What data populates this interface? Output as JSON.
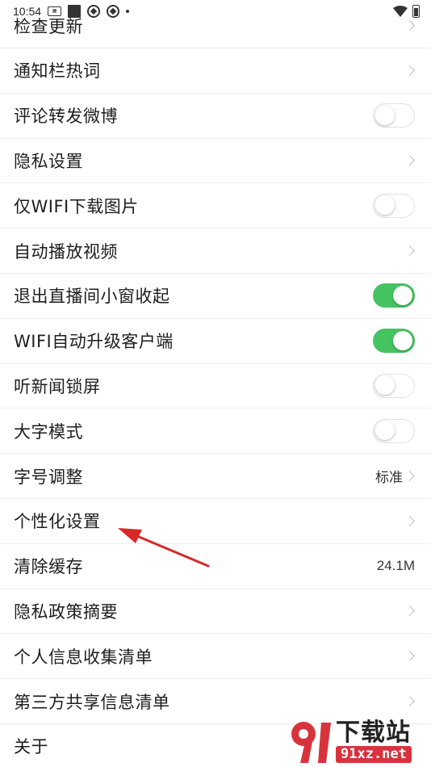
{
  "status_bar": {
    "time": "10:54"
  },
  "settings": [
    {
      "label": "检查更新",
      "control": "chevron"
    },
    {
      "label": "通知栏热词",
      "control": "chevron"
    },
    {
      "label": "评论转发微博",
      "control": "toggle",
      "on": false
    },
    {
      "label": "隐私设置",
      "control": "chevron"
    },
    {
      "label": "仅WIFI下载图片",
      "control": "toggle",
      "on": false
    },
    {
      "label": "自动播放视频",
      "control": "chevron"
    },
    {
      "label": "退出直播间小窗收起",
      "control": "toggle",
      "on": true
    },
    {
      "label": "WIFI自动升级客户端",
      "control": "toggle",
      "on": true
    },
    {
      "label": "听新闻锁屏",
      "control": "toggle",
      "on": false
    },
    {
      "label": "大字模式",
      "control": "toggle",
      "on": false
    },
    {
      "label": "字号调整",
      "control": "value-chevron",
      "value": "标准"
    },
    {
      "label": "个性化设置",
      "control": "chevron"
    },
    {
      "label": "清除缓存",
      "control": "value",
      "value": "24.1M"
    },
    {
      "label": "隐私政策摘要",
      "control": "chevron"
    },
    {
      "label": "个人信息收集清单",
      "control": "chevron"
    },
    {
      "label": "第三方共享信息清单",
      "control": "chevron"
    },
    {
      "label": "关于",
      "control": "none"
    }
  ],
  "colors": {
    "toggle_on": "#46c361",
    "annotation_arrow": "#d62a2a",
    "watermark_red": "#d8333d"
  },
  "watermark": {
    "title": "下载站",
    "url": "91xz.net"
  }
}
